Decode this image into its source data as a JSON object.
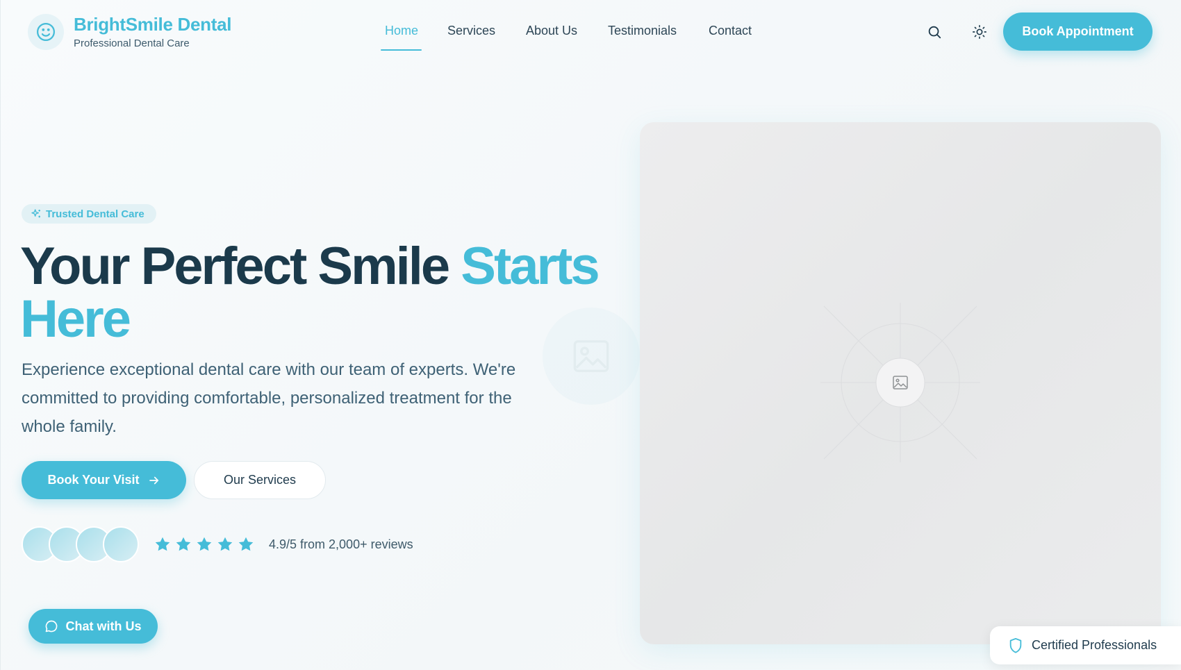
{
  "brand": {
    "name": "BrightSmile Dental",
    "tagline": "Professional Dental Care",
    "logo_icon": "smile-icon"
  },
  "nav": {
    "items": [
      {
        "label": "Home",
        "active": true
      },
      {
        "label": "Services",
        "active": false
      },
      {
        "label": "About Us",
        "active": false
      },
      {
        "label": "Testimonials",
        "active": false
      },
      {
        "label": "Contact",
        "active": false
      }
    ]
  },
  "header_actions": {
    "search_icon": "search-icon",
    "theme_icon": "sun-icon",
    "book_label": "Book Appointment"
  },
  "hero": {
    "badge": "Trusted Dental Care",
    "badge_icon": "sparkles-icon",
    "headline_main": "Your Perfect Smile ",
    "headline_accent": "Starts Here",
    "description": "Experience exceptional dental care with our team of experts. We're committed to providing comfortable, personalized treatment for the whole family.",
    "primary_cta": "Book Your Visit",
    "primary_cta_icon": "arrow-right-icon",
    "secondary_cta": "Our Services",
    "rating": {
      "stars": 5,
      "text": "4.9/5 from 2,000+ reviews"
    },
    "image_icon": "image-icon"
  },
  "chat": {
    "label": "Chat with Us",
    "icon": "chat-bubble-icon"
  },
  "certified": {
    "label": "Certified Professionals",
    "icon": "shield-icon"
  },
  "colors": {
    "accent": "#45bcd8",
    "heading": "#1b3a4b",
    "body": "#3e6175"
  }
}
